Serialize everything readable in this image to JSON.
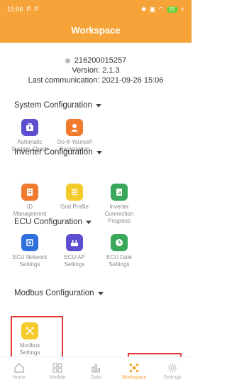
{
  "status_bar": {
    "time": "15:06",
    "battery": "97"
  },
  "header": {
    "title": "Workspace"
  },
  "device": {
    "id": "216200015257",
    "version": "Version: 2.1.3",
    "last_comm": "Last communication: 2021-09-26 15:06"
  },
  "sections": {
    "system": {
      "title": "System Configuration",
      "items": [
        {
          "label": "Automatic System Check",
          "icon": "toolbox-icon",
          "color": "#5b4fcf"
        },
        {
          "label": "Do-It-Yourself Registration",
          "icon": "person-icon",
          "color": "#f07a2e"
        }
      ]
    },
    "inverter": {
      "title": "Inverter Configuration",
      "items": [
        {
          "label": "ID Management",
          "icon": "document-icon",
          "color": "#f07a2e"
        },
        {
          "label": "Grid Profile",
          "icon": "list-icon",
          "color": "#f5cb2b"
        },
        {
          "label": "Inverter Connection Progress",
          "icon": "progress-icon",
          "color": "#3aa85a"
        }
      ]
    },
    "ecu": {
      "title": "ECU Configuration",
      "items": [
        {
          "label": "ECU Network Settings",
          "icon": "network-icon",
          "color": "#2e6fdb"
        },
        {
          "label": "ECU AP Settings",
          "icon": "ap-icon",
          "color": "#5b4fcf"
        },
        {
          "label": "ECU Date Settings",
          "icon": "clock-icon",
          "color": "#3aa85a"
        }
      ]
    },
    "modbus": {
      "title": "Modbus Configuration",
      "items": [
        {
          "label": "Modbus Settings",
          "icon": "modbus-icon",
          "color": "#f5cb2b"
        }
      ]
    }
  },
  "tabs": [
    {
      "label": "Home",
      "icon": "home-icon"
    },
    {
      "label": "Module",
      "icon": "module-icon"
    },
    {
      "label": "Data",
      "icon": "data-icon"
    },
    {
      "label": "Workspace",
      "icon": "workspace-icon"
    },
    {
      "label": "Settings",
      "icon": "settings-icon"
    }
  ],
  "colors": {
    "accent": "#f6a43a",
    "highlight": "#e53935"
  }
}
